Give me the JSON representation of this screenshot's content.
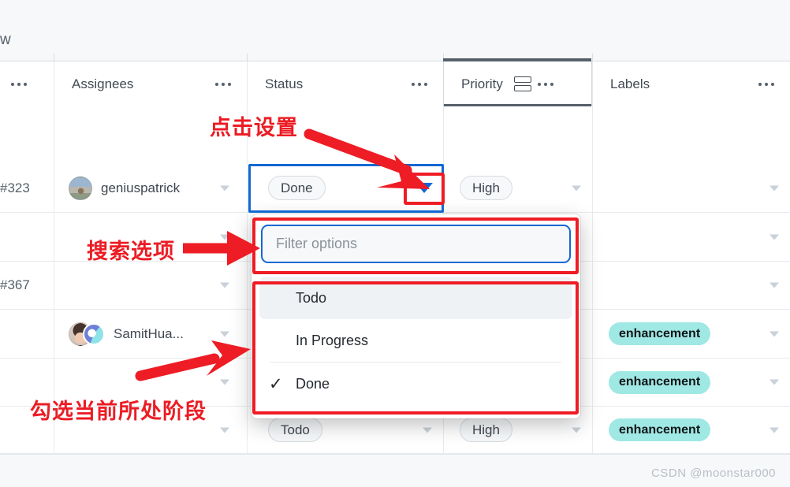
{
  "window": {
    "cut_off_title": "w",
    "watermark": "CSDN @moonstar000"
  },
  "table": {
    "columns": [
      {
        "name": "row-number",
        "label": "",
        "kebab": "•••",
        "active": false
      },
      {
        "name": "assignees",
        "label": "Assignees",
        "kebab": "•••",
        "active": false
      },
      {
        "name": "status",
        "label": "Status",
        "kebab": "•••",
        "active": false
      },
      {
        "name": "priority",
        "label": "Priority",
        "kebab": "•••",
        "active": true,
        "group_icon": "group-rows-icon"
      },
      {
        "name": "labels",
        "label": "Labels",
        "kebab": "•••",
        "active": false
      }
    ],
    "rows": [
      {
        "id": "#323",
        "assignee": "geniuspatrick",
        "avatar": "cat-avatar",
        "status": "Done",
        "priority": "High",
        "label": ""
      },
      {
        "id": "",
        "assignee": "",
        "avatar": "",
        "status": "",
        "priority": "",
        "label": ""
      },
      {
        "id": "#367",
        "assignee": "",
        "avatar": "",
        "status": "",
        "priority": "",
        "label": ""
      },
      {
        "id": "",
        "assignee": "SamitHua...",
        "avatar": "kid-avatar",
        "status": "",
        "priority": "",
        "label": "enhancement"
      },
      {
        "id": "",
        "assignee": "",
        "avatar": "",
        "status": "",
        "priority": "",
        "label": "enhancement"
      },
      {
        "id": "",
        "assignee": "",
        "avatar": "",
        "status": "Todo",
        "priority": "High",
        "label": "enhancement"
      }
    ]
  },
  "dropdown": {
    "filter_placeholder": "Filter options",
    "options": [
      {
        "label": "Todo",
        "checked": false,
        "highlighted": true
      },
      {
        "label": "In Progress",
        "checked": false,
        "highlighted": false
      },
      {
        "label": "Done",
        "checked": true,
        "highlighted": false
      }
    ],
    "check_glyph": "✓"
  },
  "annotations": [
    {
      "name": "click-settings",
      "text": "点击设置"
    },
    {
      "name": "search-options",
      "text": "搜索选项"
    },
    {
      "name": "check-current-stage",
      "text": "勾选当前所处阶段"
    }
  ],
  "colors": {
    "annotation_red": "#ee1c25",
    "focus_blue": "#1268d3",
    "label_teal": "#9fe8e3",
    "header_text": "#424a53"
  }
}
